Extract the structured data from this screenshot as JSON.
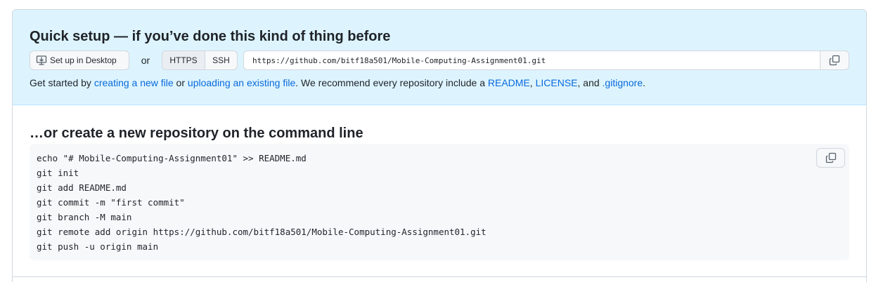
{
  "quick_setup": {
    "title": "Quick setup — if you’ve done this kind of thing before",
    "desktop_button": "Set up in Desktop",
    "or_label": "or",
    "protocols": [
      "HTTPS",
      "SSH"
    ],
    "selected_protocol": "HTTPS",
    "clone_url": "https://github.com/bitf18a501/Mobile-Computing-Assignment01.git",
    "get_started": {
      "prefix": "Get started by ",
      "link_new_file": "creating a new file",
      "middle": " or ",
      "link_upload": "uploading an existing file",
      "recommend": ". We recommend every repository include a ",
      "link_readme": "README",
      "comma1": ", ",
      "link_license": "LICENSE",
      "comma2": ", and ",
      "link_gitignore": ".gitignore",
      "suffix": "."
    }
  },
  "command_line": {
    "title": "…or create a new repository on the command line",
    "lines": [
      "echo \"# Mobile-Computing-Assignment01\" >> README.md",
      "git init",
      "git add README.md",
      "git commit -m \"first commit\"",
      "git branch -M main",
      "git remote add origin https://github.com/bitf18a501/Mobile-Computing-Assignment01.git",
      "git push -u origin main"
    ]
  },
  "icons": {
    "desktop": "desktop-download-icon",
    "copy": "copy-icon"
  },
  "colors": {
    "quick_bg": "#ddf4ff",
    "link": "#0969da",
    "code_bg": "#f6f8fa"
  }
}
